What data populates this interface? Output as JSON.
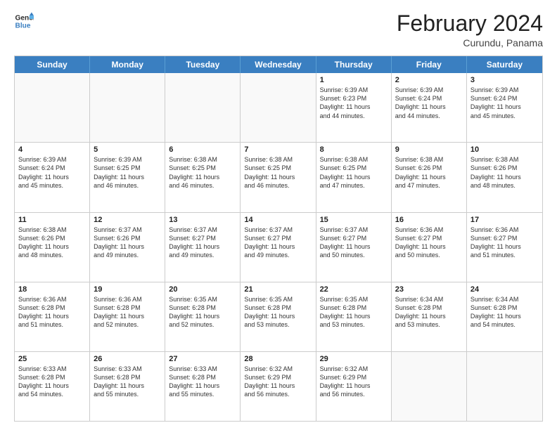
{
  "header": {
    "logo_line1": "General",
    "logo_line2": "Blue",
    "month_title": "February 2024",
    "location": "Curundu, Panama"
  },
  "weekdays": [
    "Sunday",
    "Monday",
    "Tuesday",
    "Wednesday",
    "Thursday",
    "Friday",
    "Saturday"
  ],
  "rows": [
    [
      {
        "day": "",
        "info": ""
      },
      {
        "day": "",
        "info": ""
      },
      {
        "day": "",
        "info": ""
      },
      {
        "day": "",
        "info": ""
      },
      {
        "day": "1",
        "info": "Sunrise: 6:39 AM\nSunset: 6:23 PM\nDaylight: 11 hours\nand 44 minutes."
      },
      {
        "day": "2",
        "info": "Sunrise: 6:39 AM\nSunset: 6:24 PM\nDaylight: 11 hours\nand 44 minutes."
      },
      {
        "day": "3",
        "info": "Sunrise: 6:39 AM\nSunset: 6:24 PM\nDaylight: 11 hours\nand 45 minutes."
      }
    ],
    [
      {
        "day": "4",
        "info": "Sunrise: 6:39 AM\nSunset: 6:24 PM\nDaylight: 11 hours\nand 45 minutes."
      },
      {
        "day": "5",
        "info": "Sunrise: 6:39 AM\nSunset: 6:25 PM\nDaylight: 11 hours\nand 46 minutes."
      },
      {
        "day": "6",
        "info": "Sunrise: 6:38 AM\nSunset: 6:25 PM\nDaylight: 11 hours\nand 46 minutes."
      },
      {
        "day": "7",
        "info": "Sunrise: 6:38 AM\nSunset: 6:25 PM\nDaylight: 11 hours\nand 46 minutes."
      },
      {
        "day": "8",
        "info": "Sunrise: 6:38 AM\nSunset: 6:25 PM\nDaylight: 11 hours\nand 47 minutes."
      },
      {
        "day": "9",
        "info": "Sunrise: 6:38 AM\nSunset: 6:26 PM\nDaylight: 11 hours\nand 47 minutes."
      },
      {
        "day": "10",
        "info": "Sunrise: 6:38 AM\nSunset: 6:26 PM\nDaylight: 11 hours\nand 48 minutes."
      }
    ],
    [
      {
        "day": "11",
        "info": "Sunrise: 6:38 AM\nSunset: 6:26 PM\nDaylight: 11 hours\nand 48 minutes."
      },
      {
        "day": "12",
        "info": "Sunrise: 6:37 AM\nSunset: 6:26 PM\nDaylight: 11 hours\nand 49 minutes."
      },
      {
        "day": "13",
        "info": "Sunrise: 6:37 AM\nSunset: 6:27 PM\nDaylight: 11 hours\nand 49 minutes."
      },
      {
        "day": "14",
        "info": "Sunrise: 6:37 AM\nSunset: 6:27 PM\nDaylight: 11 hours\nand 49 minutes."
      },
      {
        "day": "15",
        "info": "Sunrise: 6:37 AM\nSunset: 6:27 PM\nDaylight: 11 hours\nand 50 minutes."
      },
      {
        "day": "16",
        "info": "Sunrise: 6:36 AM\nSunset: 6:27 PM\nDaylight: 11 hours\nand 50 minutes."
      },
      {
        "day": "17",
        "info": "Sunrise: 6:36 AM\nSunset: 6:27 PM\nDaylight: 11 hours\nand 51 minutes."
      }
    ],
    [
      {
        "day": "18",
        "info": "Sunrise: 6:36 AM\nSunset: 6:28 PM\nDaylight: 11 hours\nand 51 minutes."
      },
      {
        "day": "19",
        "info": "Sunrise: 6:36 AM\nSunset: 6:28 PM\nDaylight: 11 hours\nand 52 minutes."
      },
      {
        "day": "20",
        "info": "Sunrise: 6:35 AM\nSunset: 6:28 PM\nDaylight: 11 hours\nand 52 minutes."
      },
      {
        "day": "21",
        "info": "Sunrise: 6:35 AM\nSunset: 6:28 PM\nDaylight: 11 hours\nand 53 minutes."
      },
      {
        "day": "22",
        "info": "Sunrise: 6:35 AM\nSunset: 6:28 PM\nDaylight: 11 hours\nand 53 minutes."
      },
      {
        "day": "23",
        "info": "Sunrise: 6:34 AM\nSunset: 6:28 PM\nDaylight: 11 hours\nand 53 minutes."
      },
      {
        "day": "24",
        "info": "Sunrise: 6:34 AM\nSunset: 6:28 PM\nDaylight: 11 hours\nand 54 minutes."
      }
    ],
    [
      {
        "day": "25",
        "info": "Sunrise: 6:33 AM\nSunset: 6:28 PM\nDaylight: 11 hours\nand 54 minutes."
      },
      {
        "day": "26",
        "info": "Sunrise: 6:33 AM\nSunset: 6:28 PM\nDaylight: 11 hours\nand 55 minutes."
      },
      {
        "day": "27",
        "info": "Sunrise: 6:33 AM\nSunset: 6:28 PM\nDaylight: 11 hours\nand 55 minutes."
      },
      {
        "day": "28",
        "info": "Sunrise: 6:32 AM\nSunset: 6:29 PM\nDaylight: 11 hours\nand 56 minutes."
      },
      {
        "day": "29",
        "info": "Sunrise: 6:32 AM\nSunset: 6:29 PM\nDaylight: 11 hours\nand 56 minutes."
      },
      {
        "day": "",
        "info": ""
      },
      {
        "day": "",
        "info": ""
      }
    ]
  ]
}
